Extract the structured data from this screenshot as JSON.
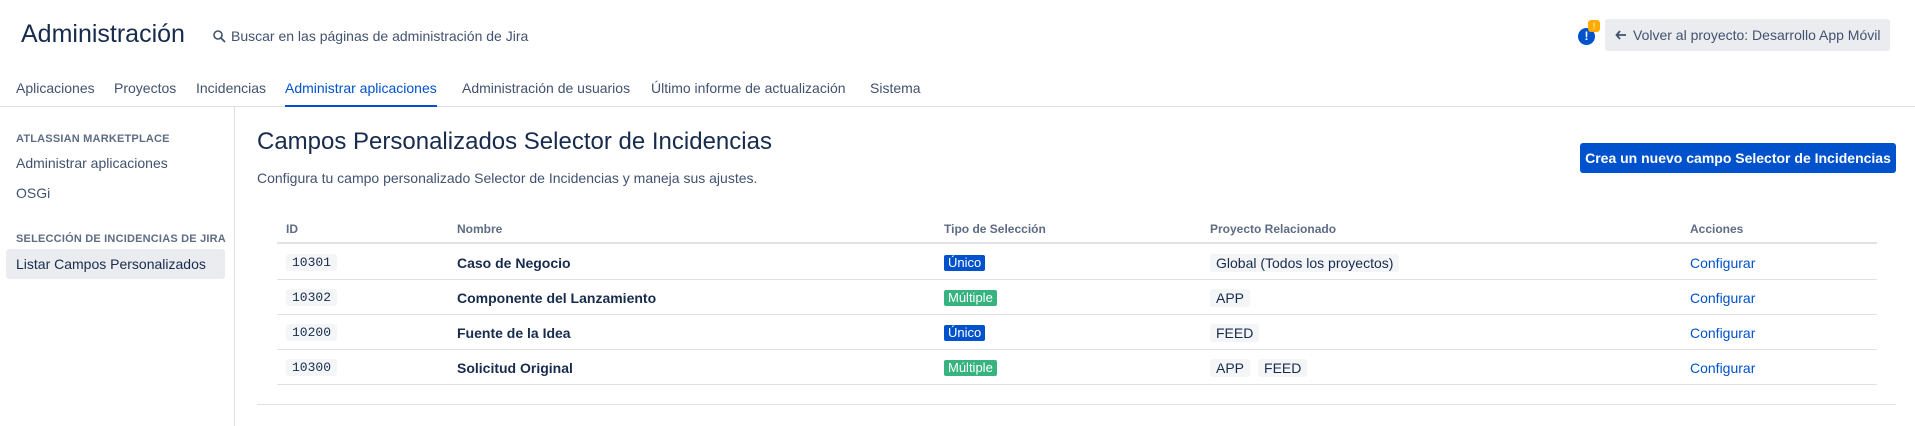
{
  "header": {
    "title": "Administración",
    "search_placeholder": "Buscar en las páginas de administración de Jira",
    "notification_badge": "!",
    "notification_icon": "!",
    "back_label": "Volver al proyecto: Desarrollo App Móvil",
    "back_icon": "arrow-left-icon"
  },
  "tabs": [
    {
      "label": "Aplicaciones",
      "active": false
    },
    {
      "label": "Proyectos",
      "active": false
    },
    {
      "label": "Incidencias",
      "active": false
    },
    {
      "label": "Administrar aplicaciones",
      "active": true
    },
    {
      "label": "Administración de usuarios",
      "active": false
    },
    {
      "label": "Último informe de actualización",
      "active": false
    },
    {
      "label": "Sistema",
      "active": false
    }
  ],
  "sidebar": {
    "section1": {
      "heading": "ATLASSIAN MARKETPLACE",
      "items": [
        "Administrar aplicaciones",
        "OSGi"
      ]
    },
    "section2": {
      "heading": "SELECCIÓN DE INCIDENCIAS DE JIRA",
      "items": [
        "Listar Campos Personalizados"
      ]
    }
  },
  "main": {
    "title": "Campos Personalizados Selector de Incidencias",
    "description": "Configura tu campo personalizado Selector de Incidencias y maneja sus ajustes.",
    "create_button": "Crea un nuevo campo Selector de Incidencias"
  },
  "table": {
    "headers": {
      "id": "ID",
      "name": "Nombre",
      "selection_type": "Tipo de Selección",
      "project": "Proyecto Relacionado",
      "actions": "Acciones"
    },
    "rows": [
      {
        "id": "10301",
        "name": "Caso de Negocio",
        "type": "Único",
        "projects": [
          "Global (Todos los proyectos)"
        ],
        "action": "Configurar"
      },
      {
        "id": "10302",
        "name": "Componente del Lanzamiento",
        "type": "Múltiple",
        "projects": [
          "APP"
        ],
        "action": "Configurar"
      },
      {
        "id": "10200",
        "name": "Fuente de la Idea",
        "type": "Único",
        "projects": [
          "FEED"
        ],
        "action": "Configurar"
      },
      {
        "id": "10300",
        "name": "Solicitud Original",
        "type": "Múltiple",
        "projects": [
          "APP",
          "FEED"
        ],
        "action": "Configurar"
      }
    ]
  },
  "colors": {
    "primary": "#0052cc",
    "single_lozenge": "#0052cc",
    "multiple_lozenge": "#36b37e",
    "warning_badge": "#ffab00"
  }
}
